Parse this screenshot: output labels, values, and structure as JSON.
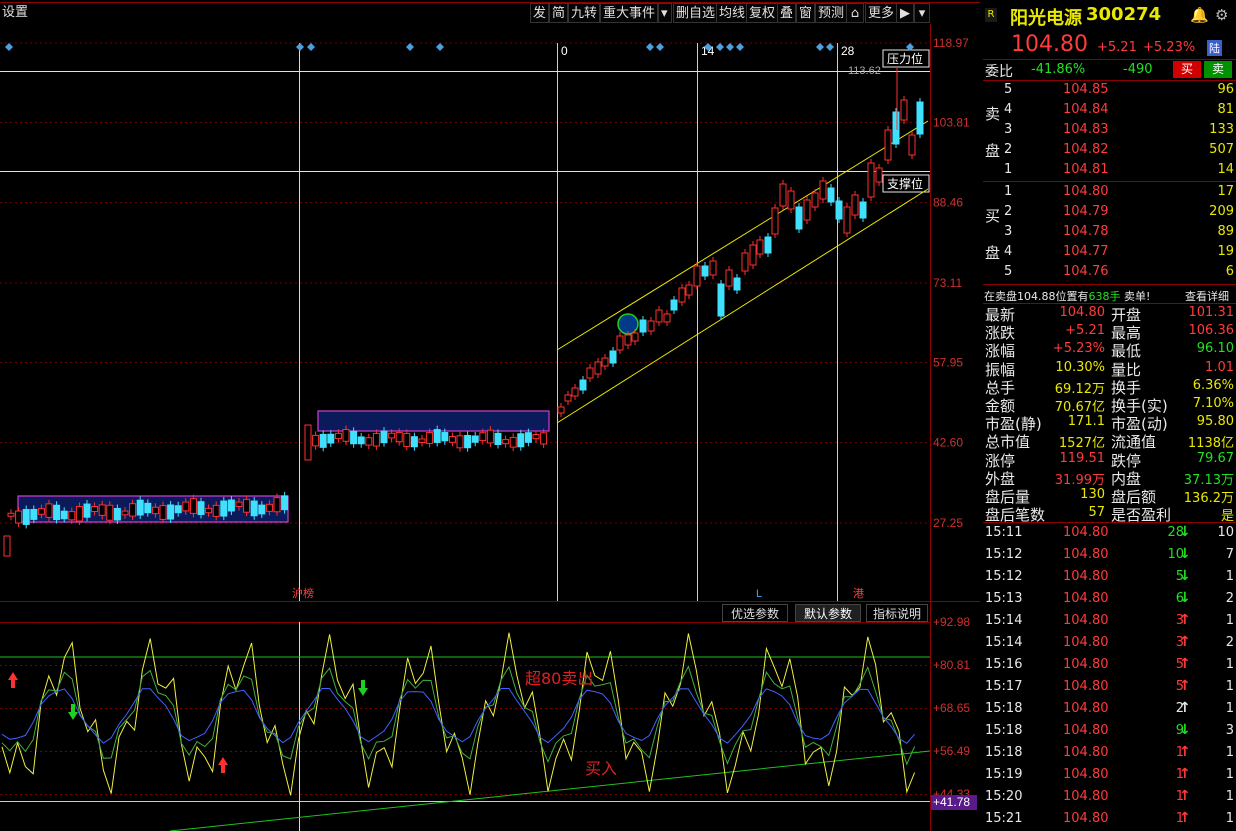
{
  "toolbar": {
    "left_label": "设置",
    "items": [
      "发",
      "简",
      "九转",
      "重大事件",
      "删自选",
      "均线",
      "复权",
      "叠",
      "窗",
      "预测",
      "更多"
    ]
  },
  "main_chart": {
    "y_ticks": [
      "118.97",
      "103.81",
      "88.46",
      "73.11",
      "57.95",
      "42.60",
      "27.25"
    ],
    "day_marks": [
      "0",
      "14",
      "28"
    ],
    "labels": {
      "pressure": "压力位",
      "support": "支撑位",
      "peak_price": "113.62",
      "bottom_left": "沪榜",
      "bottom_mid": "L",
      "bottom_right": "港"
    }
  },
  "indicator_tabs": [
    "优选参数",
    "默认参数",
    "指标说明"
  ],
  "indicator": {
    "y_ticks": [
      "92.98",
      "80.81",
      "68.65",
      "56.49",
      "44.33",
      "41.78"
    ],
    "annotations": {
      "sell": "超80卖出",
      "buy": "买入"
    }
  },
  "quote": {
    "badge": "R",
    "name": "阳光电源",
    "code": "300274",
    "price": "104.80",
    "change": "+5.21",
    "change_pct": "+5.23%",
    "flag": "陆",
    "ratio_label": "委比",
    "ratio": "-41.86%",
    "diff": "-490",
    "buy_btn": "买",
    "sell_btn": "卖",
    "sell_side_label": [
      "卖",
      "盘"
    ],
    "buy_side_label": [
      "买",
      "盘"
    ],
    "asks": [
      {
        "lvl": "5",
        "price": "104.85",
        "vol": "96"
      },
      {
        "lvl": "4",
        "price": "104.84",
        "vol": "81"
      },
      {
        "lvl": "3",
        "price": "104.83",
        "vol": "133"
      },
      {
        "lvl": "2",
        "price": "104.82",
        "vol": "507"
      },
      {
        "lvl": "1",
        "price": "104.81",
        "vol": "14"
      }
    ],
    "bids": [
      {
        "lvl": "1",
        "price": "104.80",
        "vol": "17"
      },
      {
        "lvl": "2",
        "price": "104.79",
        "vol": "209"
      },
      {
        "lvl": "3",
        "price": "104.78",
        "vol": "89"
      },
      {
        "lvl": "4",
        "price": "104.77",
        "vol": "19"
      },
      {
        "lvl": "5",
        "price": "104.76",
        "vol": "6"
      }
    ],
    "notice_pre": "在卖盘104.88位置有",
    "notice_vol": "638手",
    "notice_post": "卖单!",
    "notice_link": "查看详细",
    "stats": [
      [
        "最新",
        "104.80",
        "开盘",
        "101.31"
      ],
      [
        "涨跌",
        "+5.21",
        "最高",
        "106.36"
      ],
      [
        "涨幅",
        "+5.23%",
        "最低",
        "96.10"
      ],
      [
        "振幅",
        "10.30%",
        "量比",
        "1.01"
      ],
      [
        "总手",
        "69.12万",
        "换手",
        "6.36%"
      ],
      [
        "金额",
        "70.67亿",
        "换手(实)",
        "7.10%"
      ],
      [
        "市盈(静)",
        "171.1",
        "市盈(动)",
        "95.80"
      ],
      [
        "总市值",
        "1527亿",
        "流通值",
        "1138亿"
      ],
      [
        "涨停",
        "119.51",
        "跌停",
        "79.67"
      ],
      [
        "外盘",
        "31.99万",
        "内盘",
        "37.13万"
      ],
      [
        "盘后量",
        "130",
        "盘后额",
        "136.2万"
      ],
      [
        "盘后笔数",
        "57",
        "是否盈利",
        "是"
      ]
    ],
    "ticks": [
      {
        "time": "15:11",
        "price": "104.80",
        "vol": "28",
        "dir": "down",
        "n": "10"
      },
      {
        "time": "15:12",
        "price": "104.80",
        "vol": "10",
        "dir": "down",
        "n": "7"
      },
      {
        "time": "15:12",
        "price": "104.80",
        "vol": "5",
        "dir": "down",
        "n": "1"
      },
      {
        "time": "15:13",
        "price": "104.80",
        "vol": "6",
        "dir": "down",
        "n": "2"
      },
      {
        "time": "15:14",
        "price": "104.80",
        "vol": "3",
        "dir": "up",
        "n": "1"
      },
      {
        "time": "15:14",
        "price": "104.80",
        "vol": "3",
        "dir": "up",
        "n": "2"
      },
      {
        "time": "15:16",
        "price": "104.80",
        "vol": "5",
        "dir": "up",
        "n": "1"
      },
      {
        "time": "15:17",
        "price": "104.80",
        "vol": "5",
        "dir": "up",
        "n": "1"
      },
      {
        "time": "15:18",
        "price": "104.80",
        "vol": "2",
        "dir": "white",
        "n": "1"
      },
      {
        "time": "15:18",
        "price": "104.80",
        "vol": "9",
        "dir": "down",
        "n": "3"
      },
      {
        "time": "15:18",
        "price": "104.80",
        "vol": "1",
        "dir": "up",
        "n": "1"
      },
      {
        "time": "15:19",
        "price": "104.80",
        "vol": "1",
        "dir": "up",
        "n": "1"
      },
      {
        "time": "15:20",
        "price": "104.80",
        "vol": "1",
        "dir": "up",
        "n": "1"
      },
      {
        "time": "15:21",
        "price": "104.80",
        "vol": "1",
        "dir": "up",
        "n": "1"
      }
    ]
  }
}
